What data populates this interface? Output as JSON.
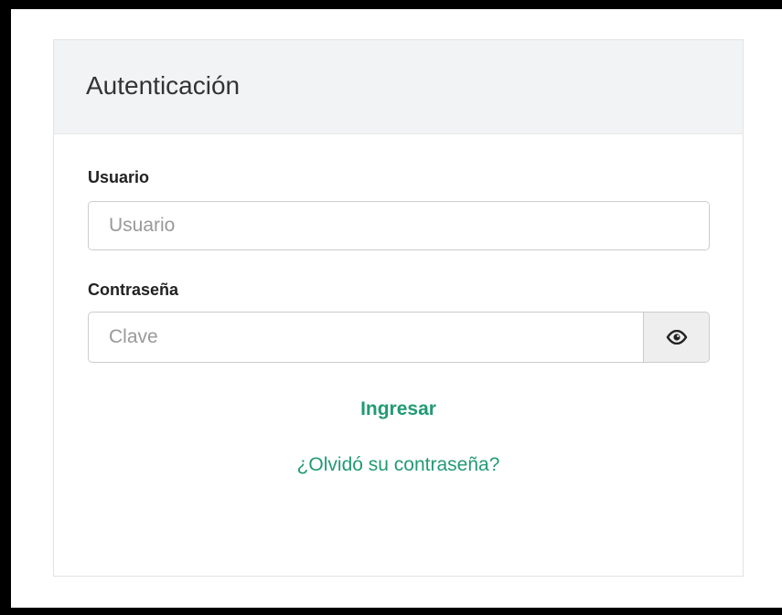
{
  "panel": {
    "title": "Autenticación"
  },
  "form": {
    "user_label": "Usuario",
    "user_placeholder": "Usuario",
    "password_label": "Contraseña",
    "password_placeholder": "Clave",
    "toggle_icon": "eye-icon",
    "submit_label": "Ingresar",
    "forgot_label": "¿Olvidó su contraseña?"
  },
  "colors": {
    "accent": "#229a74",
    "heading_bg": "#f2f3f5",
    "frame": "#000000"
  }
}
